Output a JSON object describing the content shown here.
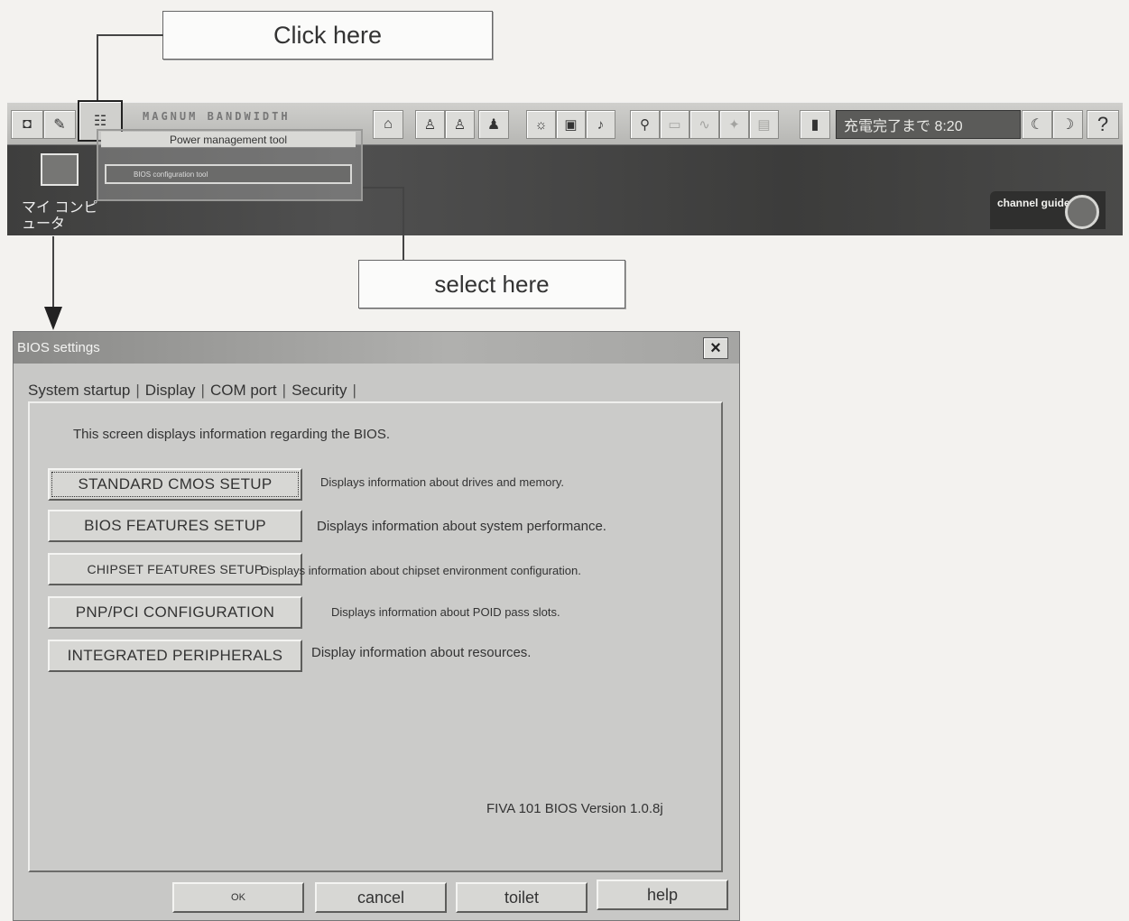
{
  "callouts": {
    "click_here": "Click here",
    "select_here": "select here"
  },
  "taskbar": {
    "brand_text": "MAGNUM BANDWIDTH",
    "status_text": "充電完了まで 8:20",
    "help_label": "?"
  },
  "popup_menu": {
    "item_1": "Power management tool",
    "item_2": "BIOS configuration tool"
  },
  "desktop": {
    "icon_label": "マイ コンピュータ",
    "channel_guide": "channel guide"
  },
  "dialog": {
    "title": "BIOS settings",
    "close_label": "×",
    "tabs": [
      "System startup",
      "Display",
      "COM port",
      "Security"
    ],
    "tab_separator": "|",
    "intro": "This screen displays information regarding the BIOS.",
    "items": [
      {
        "label": "STANDARD CMOS SETUP",
        "desc": "Displays information about drives and memory."
      },
      {
        "label": "BIOS FEATURES SETUP",
        "desc": "Displays information about system performance."
      },
      {
        "label": "CHIPSET FEATURES SETUP",
        "desc": "Displays information about chipset environment configuration."
      },
      {
        "label": "PNP/PCI CONFIGURATION",
        "desc": "Displays information about POID pass slots."
      },
      {
        "label": "INTEGRATED PERIPHERALS",
        "desc": "Display information about resources."
      }
    ],
    "version": "FIVA 101 BIOS Version 1.0.8j",
    "footer": {
      "ok": "OK",
      "cancel": "cancel",
      "toilet": "toilet",
      "help": "help"
    }
  }
}
